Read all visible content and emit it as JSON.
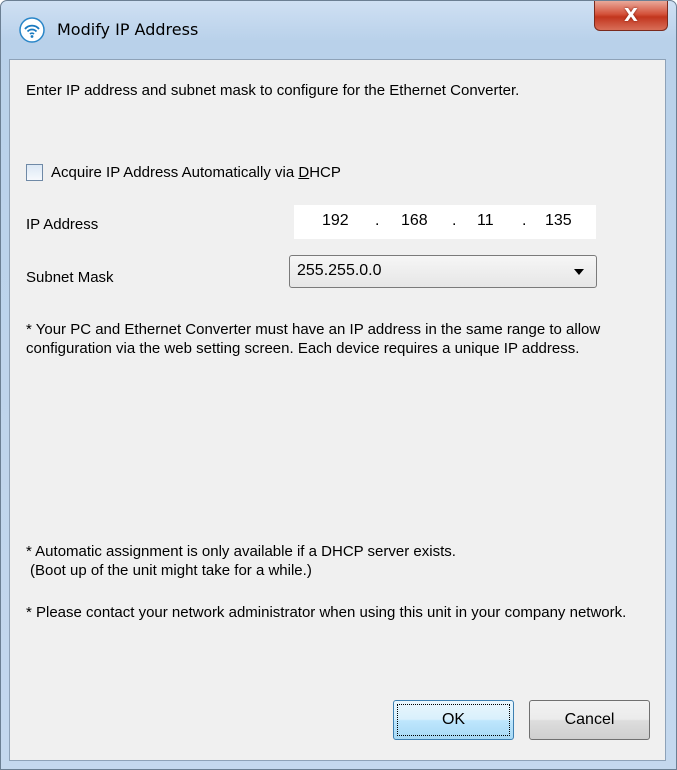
{
  "window": {
    "title": "Modify IP Address",
    "close_label": "X"
  },
  "form": {
    "intro": "Enter IP address and subnet mask to configure for the Ethernet Converter.",
    "dhcp_label_prefix": "Acquire IP Address Automatically via ",
    "dhcp_label_accel": "D",
    "dhcp_label_suffix": "HCP",
    "dhcp_checked": false,
    "ip_label": "IP Address",
    "ip_octets": [
      "192",
      "168",
      "11",
      "135"
    ],
    "ip_dot": ".",
    "mask_label": "Subnet Mask",
    "mask_value": "255.255.0.0"
  },
  "notes": {
    "note1": "* Your PC and Ethernet Converter must have an IP address in the same range to allow configuration via the web setting screen. Each device requires a unique IP address.",
    "note2_line1": "* Automatic assignment is only available if a DHCP server exists.",
    "note2_line2": "(Boot up of the unit might take for a while.)",
    "note3": "* Please contact your network administrator when using this unit in your company network."
  },
  "buttons": {
    "ok": "OK",
    "cancel": "Cancel"
  }
}
